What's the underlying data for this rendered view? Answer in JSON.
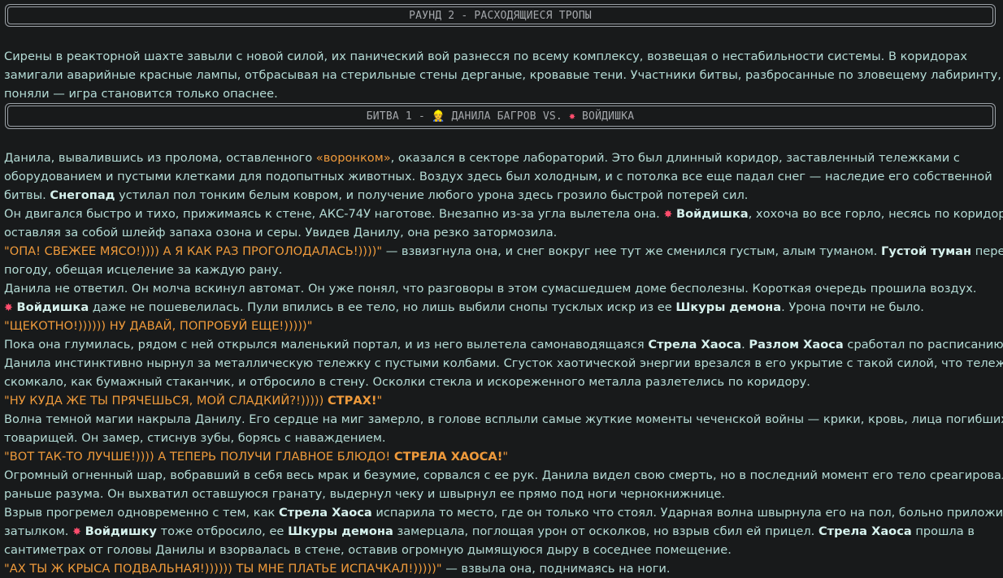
{
  "round_title": "РАУНД 2 - РАСХОДЯЩИЕСЯ ТРОПЫ",
  "battle_title": {
    "prefix": "БИТВА 1 -",
    "player1": "ДАНИЛА БАГРОВ",
    "vs": "VS.",
    "player2": "ВОЙДИШКА",
    "player1_icon": "person-emoji-icon",
    "player2_icon": "burst-icon"
  },
  "intro_lines": [
    "Сирены в реакторной шахте завыли с новой силой, их панический вой разнесся по всему комплексу, возвещая о нестабильности системы. В коридорах",
    "замигали аварийные красные лампы, отбрасывая на стерильные стены дерганые, кровавые тени. Участники битвы, разбросанные по зловещему лабиринту,",
    "поняли — игра становится только опаснее."
  ],
  "story": {
    "l1a": "Данила, вывалившись из пролома, оставленного ",
    "l1b": "«воронком»",
    "l1c": ", оказался в секторе лабораторий. Это был длинный коридор, заставленный тележками с",
    "l2": "оборудованием и пустыми клетками для подопытных животных. Воздух здесь был холодным, и с потолка все еще падал снег — наследие его собственной",
    "l3a": "битвы. ",
    "snow": "Снегопад",
    "l3b": " устилал пол тонким белым ковром, и получение любого урона здесь грозило быстрой потерей сил.",
    "l4a": "Он двигался быстро и тихо, прижимаясь к стене, АКС-74У наготове. Внезапно из-за угла вылетела она. ",
    "voidishka": "Войдишка",
    "l4b": ", хохоча во все горло, несясь по коридору,",
    "l5": "оставляя за собой шлейф запаха озона и серы. Увидев Данилу, она резко затормозила.",
    "q1": "\"ОПА! СВЕЖЕЕ МЯСО!)))) А Я КАК РАЗ ПРОГОЛОДАЛАСЬ!))))\"",
    "l6a": " — взвизгнула она, и снег вокруг нее тут же сменился густым, алым туманом. ",
    "fog": "Густой туман",
    "l6b": " перебил его",
    "l7": "погоду, обещая исцеление за каждую рану.",
    "l8": "Данила не ответил. Он молча вскинул автомат. Он уже понял, что разговоры в этом сумасшедшем доме бесполезны. Короткая очередь прошила воздух.",
    "l9a": " даже не пошевелилась. Пули впились в ее тело, но лишь выбили снопы тусклых искр из ее ",
    "demon_skin": "Шкуры демона",
    "l9b": ". Урона почти не было.",
    "q2": "\"ЩЕКОТНО!)))))) НУ ДАВАЙ, ПОПРОБУЙ ЕЩЕ!)))))\"",
    "l10a": "Пока она глумилась, рядом с ней открылся маленький портал, и из него вылетела самонаводящаяся ",
    "chaos_arrow": "Стрела Хаоса",
    "rift": "Разлом Хаоса",
    "l10b": " сработал по расписанию.",
    "l11": "Данила инстинктивно нырнул за металлическую тележку с пустыми колбами. Сгусток хаотической энергии врезался в его укрытие с такой силой, что тележку",
    "l12": "скомкало, как бумажный стаканчик, и отбросило в стену. Осколки стекла и искореженного металла разлетелись по коридору.",
    "q3a": "\"НУ КУДА ЖЕ ТЫ ПРЯЧЕШЬСЯ, МОЙ СЛАДКИЙ?!)))))",
    "q3b": "СТРАХ!",
    "q3c": "\"",
    "l13": "Волна темной магии накрыла Данилу. Его сердце на миг замерло, в голове всплыли самые жуткие моменты чеченской войны — крики, кровь, лица погибших",
    "l14": "товарищей. Он замер, стиснув зубы, борясь с наваждением.",
    "q4a": "\"ВОТ ТАК-ТО ЛУЧШЕ!)))) А ТЕПЕРЬ ПОЛУЧИ ГЛАВНОЕ БЛЮДО!",
    "q4b": "СТРЕЛА ХАОСА!",
    "q4c": "\"",
    "l15": "Огромный огненный шар, вобравший в себя весь мрак и безумие, сорвался с ее рук. Данила видел свою смерть, но в последний момент его тело среагировало",
    "l16": "раньше разума. Он выхватил оставшуюся гранату, выдернул чеку и швырнул ее прямо под ноги чернокнижнице.",
    "l17a": "Взрыв прогремел одновременно с тем, как ",
    "l17b": " испарила то место, где он только что стоял. Ударная волна швырнула его на пол, больно приложив",
    "l18a": "затылком. ",
    "voidishku": "Войдишку",
    "l18b": " тоже отбросило, ее ",
    "l18c": " замерцала, поглощая урон от осколков, но взрыв сбил ей прицел. ",
    "l18d": " прошла в",
    "l19": "сантиметрах от головы Данилы и взорвалась в стене, оставив огромную дымящуюся дыру в соседнее помещение.",
    "q5": "\"АХ ТЫ Ж КРЫСА ПОДВАЛЬНАЯ!)))))) ТЫ МНЕ ПЛАТЬЕ ИСПАЧКАЛ!)))))\"",
    "l20": " — взвыла она, поднимаясь на ноги."
  }
}
